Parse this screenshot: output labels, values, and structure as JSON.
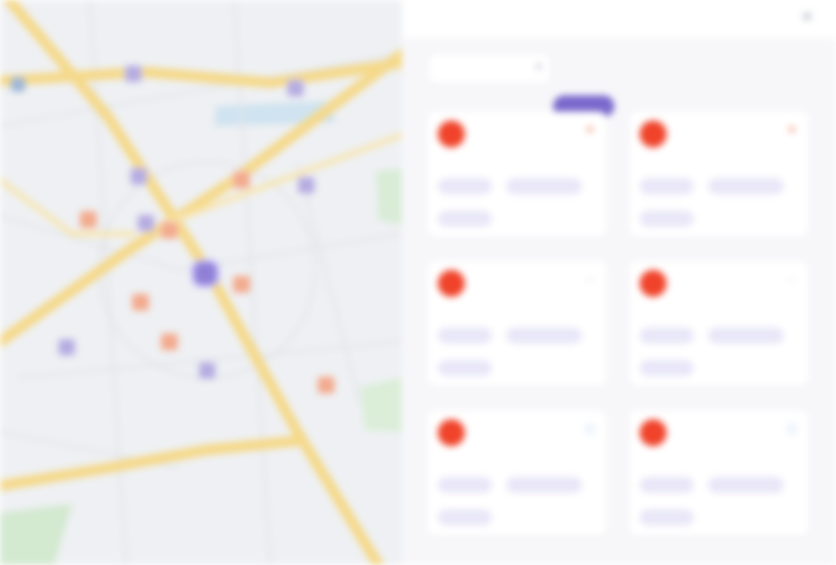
{
  "map": {
    "labels": [
      "",
      "",
      ""
    ],
    "pins": [
      {
        "kind": "blue"
      },
      {
        "kind": "purple"
      },
      {
        "kind": "purple"
      },
      {
        "kind": "orange"
      },
      {
        "kind": "purple"
      },
      {
        "kind": "orange"
      },
      {
        "kind": "orange"
      },
      {
        "kind": "purple"
      },
      {
        "kind": "orange"
      },
      {
        "kind": "purple"
      },
      {
        "kind": "orange"
      },
      {
        "kind": "purple"
      },
      {
        "kind": "orange"
      },
      {
        "kind": "purple"
      },
      {
        "kind": "orange"
      },
      {
        "kind": "big"
      }
    ]
  },
  "panel": {
    "title": "",
    "close_icon": "close-icon",
    "filter": {
      "label": "",
      "arrow_icon": "chevron-down-icon"
    },
    "new_badge": "",
    "cards": [
      {
        "avatar": "",
        "name": "",
        "meta": "",
        "action_icon": "flag-icon",
        "action_color": "#f2a08a",
        "tags": [
          "",
          "",
          ""
        ]
      },
      {
        "avatar": "",
        "name": "",
        "meta": "",
        "action_icon": "flag-icon",
        "action_color": "#f2a08a",
        "tags": [
          "",
          "",
          ""
        ]
      },
      {
        "avatar": "",
        "name": "",
        "meta": "",
        "action_icon": "more-icon",
        "action_color": "#b4acd8",
        "tags": [
          "",
          "",
          ""
        ]
      },
      {
        "avatar": "",
        "name": "",
        "meta": "",
        "action_icon": "more-icon",
        "action_color": "#b4acd8",
        "tags": [
          "",
          "",
          ""
        ]
      },
      {
        "avatar": "",
        "name": "",
        "meta": "",
        "action_icon": "info-icon",
        "action_color": "#7fb1e6",
        "tags": [
          "",
          "",
          ""
        ]
      },
      {
        "avatar": "",
        "name": "",
        "meta": "",
        "action_icon": "info-icon",
        "action_color": "#7fb1e6",
        "tags": [
          "",
          "",
          ""
        ]
      }
    ]
  },
  "colors": {
    "accent": "#7a68cc",
    "avatar": "#f0432a",
    "map_bg": "#eef0f3",
    "road": "#f5d98a"
  }
}
